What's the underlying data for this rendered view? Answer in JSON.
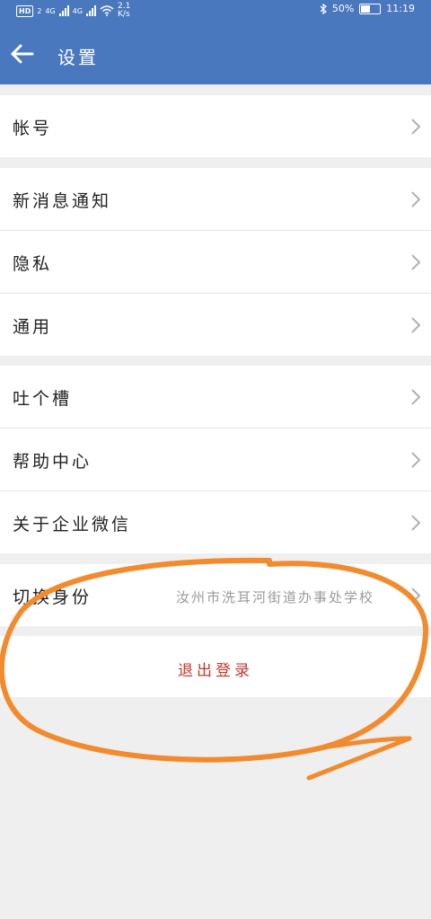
{
  "status_bar": {
    "hd_label": "HD",
    "sim_slot": "2",
    "network_1": "4G",
    "network_2": "4G",
    "speed_value": "2.1",
    "speed_unit": "K/s",
    "battery_percent": "50%",
    "time": "11:19"
  },
  "header": {
    "title": "设置",
    "back_icon": "arrow-left-icon",
    "background": "#4a78be"
  },
  "groups": [
    {
      "items": [
        {
          "label": "帐号"
        }
      ]
    },
    {
      "items": [
        {
          "label": "新消息通知"
        },
        {
          "label": "隐私"
        },
        {
          "label": "通用"
        }
      ]
    },
    {
      "items": [
        {
          "label": "吐个槽"
        },
        {
          "label": "帮助中心"
        },
        {
          "label": "关于企业微信"
        }
      ]
    },
    {
      "items": [
        {
          "label": "切换身份",
          "value": "汝州市洗耳河街道办事处学校"
        }
      ]
    }
  ],
  "logout": {
    "label": "退出登录",
    "color": "#c0392b"
  },
  "annotation": {
    "color": "#f28a2e",
    "shape": "hand-drawn-ellipse-around-logout"
  }
}
